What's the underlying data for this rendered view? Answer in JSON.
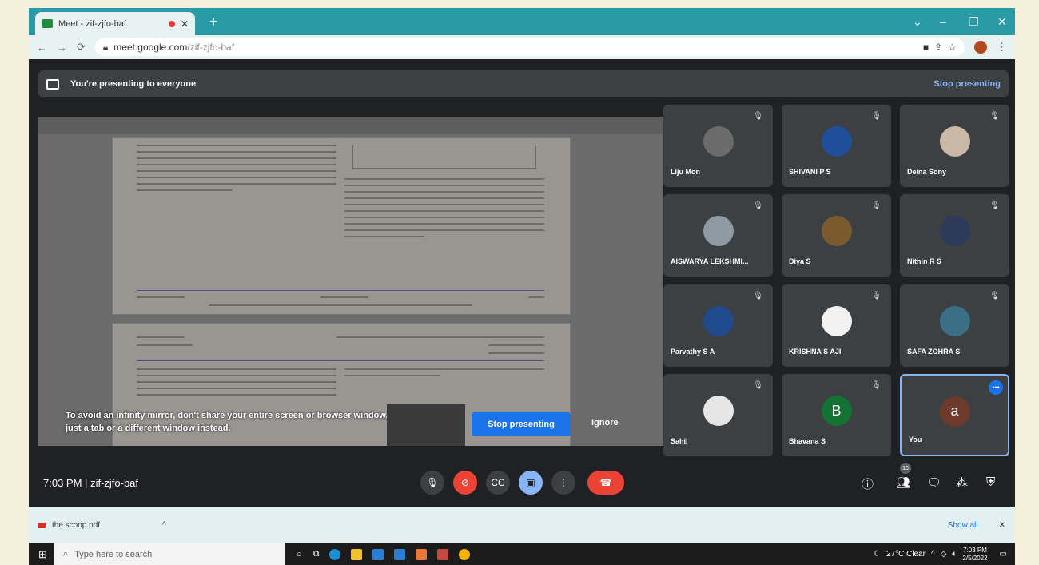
{
  "browser": {
    "tab_title": "Meet - zif-zjfo-baf",
    "url_host": "meet.google.com",
    "url_path": "/zif-zjfo-baf"
  },
  "banner": {
    "text": "You're presenting to everyone",
    "stop_label": "Stop presenting"
  },
  "warning": {
    "text": "To avoid an infinity mirror, don't share your entire screen or browser window. Share just a tab or a different window instead.",
    "stop_label": "Stop presenting",
    "ignore_label": "Ignore"
  },
  "participants": [
    {
      "name": "Liju Mon",
      "avatar": "photo",
      "color": "#6b6b6b"
    },
    {
      "name": "SHIVANI P S",
      "avatar": "photo",
      "color": "#1f4f9b"
    },
    {
      "name": "Deina Sony",
      "avatar": "photo",
      "color": "#c9b9a6"
    },
    {
      "name": "AISWARYA LEKSHMI...",
      "avatar": "photo",
      "color": "#8f9aa3"
    },
    {
      "name": "Diya S",
      "avatar": "photo",
      "color": "#7c5a2f"
    },
    {
      "name": "Nithin R S",
      "avatar": "photo",
      "color": "#2d3a5a"
    },
    {
      "name": "Parvathy S A",
      "avatar": "photo",
      "color": "#1f4a8c"
    },
    {
      "name": "KRISHNA S AJI",
      "avatar": "photo",
      "color": "#f2f2f2"
    },
    {
      "name": "SAFA ZOHRA S",
      "avatar": "photo",
      "color": "#3b6f86"
    },
    {
      "name": "Sahil",
      "avatar": "photo",
      "color": "#e6e6e6"
    },
    {
      "name": "Bhavana S",
      "avatar": "B",
      "color": "#137333"
    },
    {
      "name": "You",
      "avatar": "a",
      "color": "#6d3a2c"
    }
  ],
  "bottom": {
    "time": "7:03 PM",
    "separator": "|",
    "meeting_code": "zif-zjfo-baf",
    "participant_count": "13"
  },
  "downloads": {
    "file": "the scoop.pdf",
    "show_all": "Show all"
  },
  "taskbar": {
    "search_placeholder": "Type here to search",
    "weather": "27°C Clear",
    "time": "7:03 PM",
    "date": "2/5/2022"
  },
  "colors": {
    "meet_bg": "#202124",
    "tile_bg": "#3c4043",
    "accent": "#1a73e8",
    "end_call": "#ea4335",
    "chrome": "#2a9aa7"
  }
}
